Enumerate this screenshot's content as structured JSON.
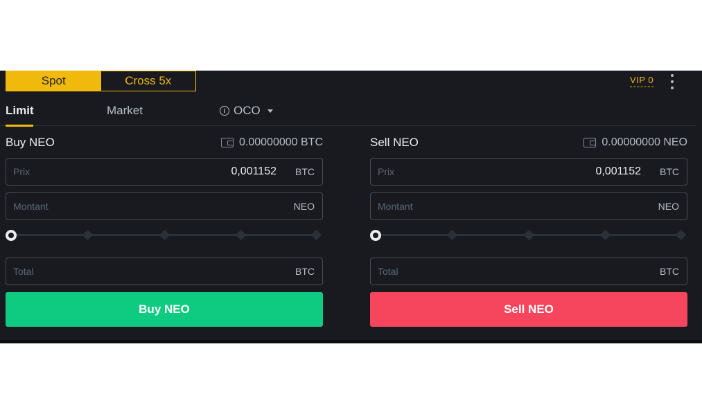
{
  "mode_toggle": {
    "spot": "Spot",
    "cross": "Cross 5x"
  },
  "vip": "VIP 0",
  "tabs": {
    "limit": "Limit",
    "market": "Market",
    "oco": "OCO"
  },
  "buy": {
    "title": "Buy NEO",
    "balance": "0.00000000 BTC",
    "price": {
      "placeholder": "Prix",
      "value": "0,001152",
      "unit": "BTC"
    },
    "amount": {
      "placeholder": "Montant",
      "unit": "NEO"
    },
    "total": {
      "placeholder": "Total",
      "unit": "BTC"
    },
    "slider_value": 0,
    "button": "Buy NEO"
  },
  "sell": {
    "title": "Sell NEO",
    "balance": "0.00000000 NEO",
    "price": {
      "placeholder": "Prix",
      "value": "0,001152",
      "unit": "BTC"
    },
    "amount": {
      "placeholder": "Montant",
      "unit": "NEO"
    },
    "total": {
      "placeholder": "Total",
      "unit": "BTC"
    },
    "slider_value": 0,
    "button": "Sell NEO"
  },
  "colors": {
    "accent": "#f0b90b",
    "buy": "#0ecb81",
    "sell": "#f6465d",
    "background": "#181a20"
  },
  "icons": {
    "info": "info-icon",
    "wallet": "wallet-icon",
    "more": "more-vertical-icon",
    "dropdown": "chevron-down-icon"
  }
}
